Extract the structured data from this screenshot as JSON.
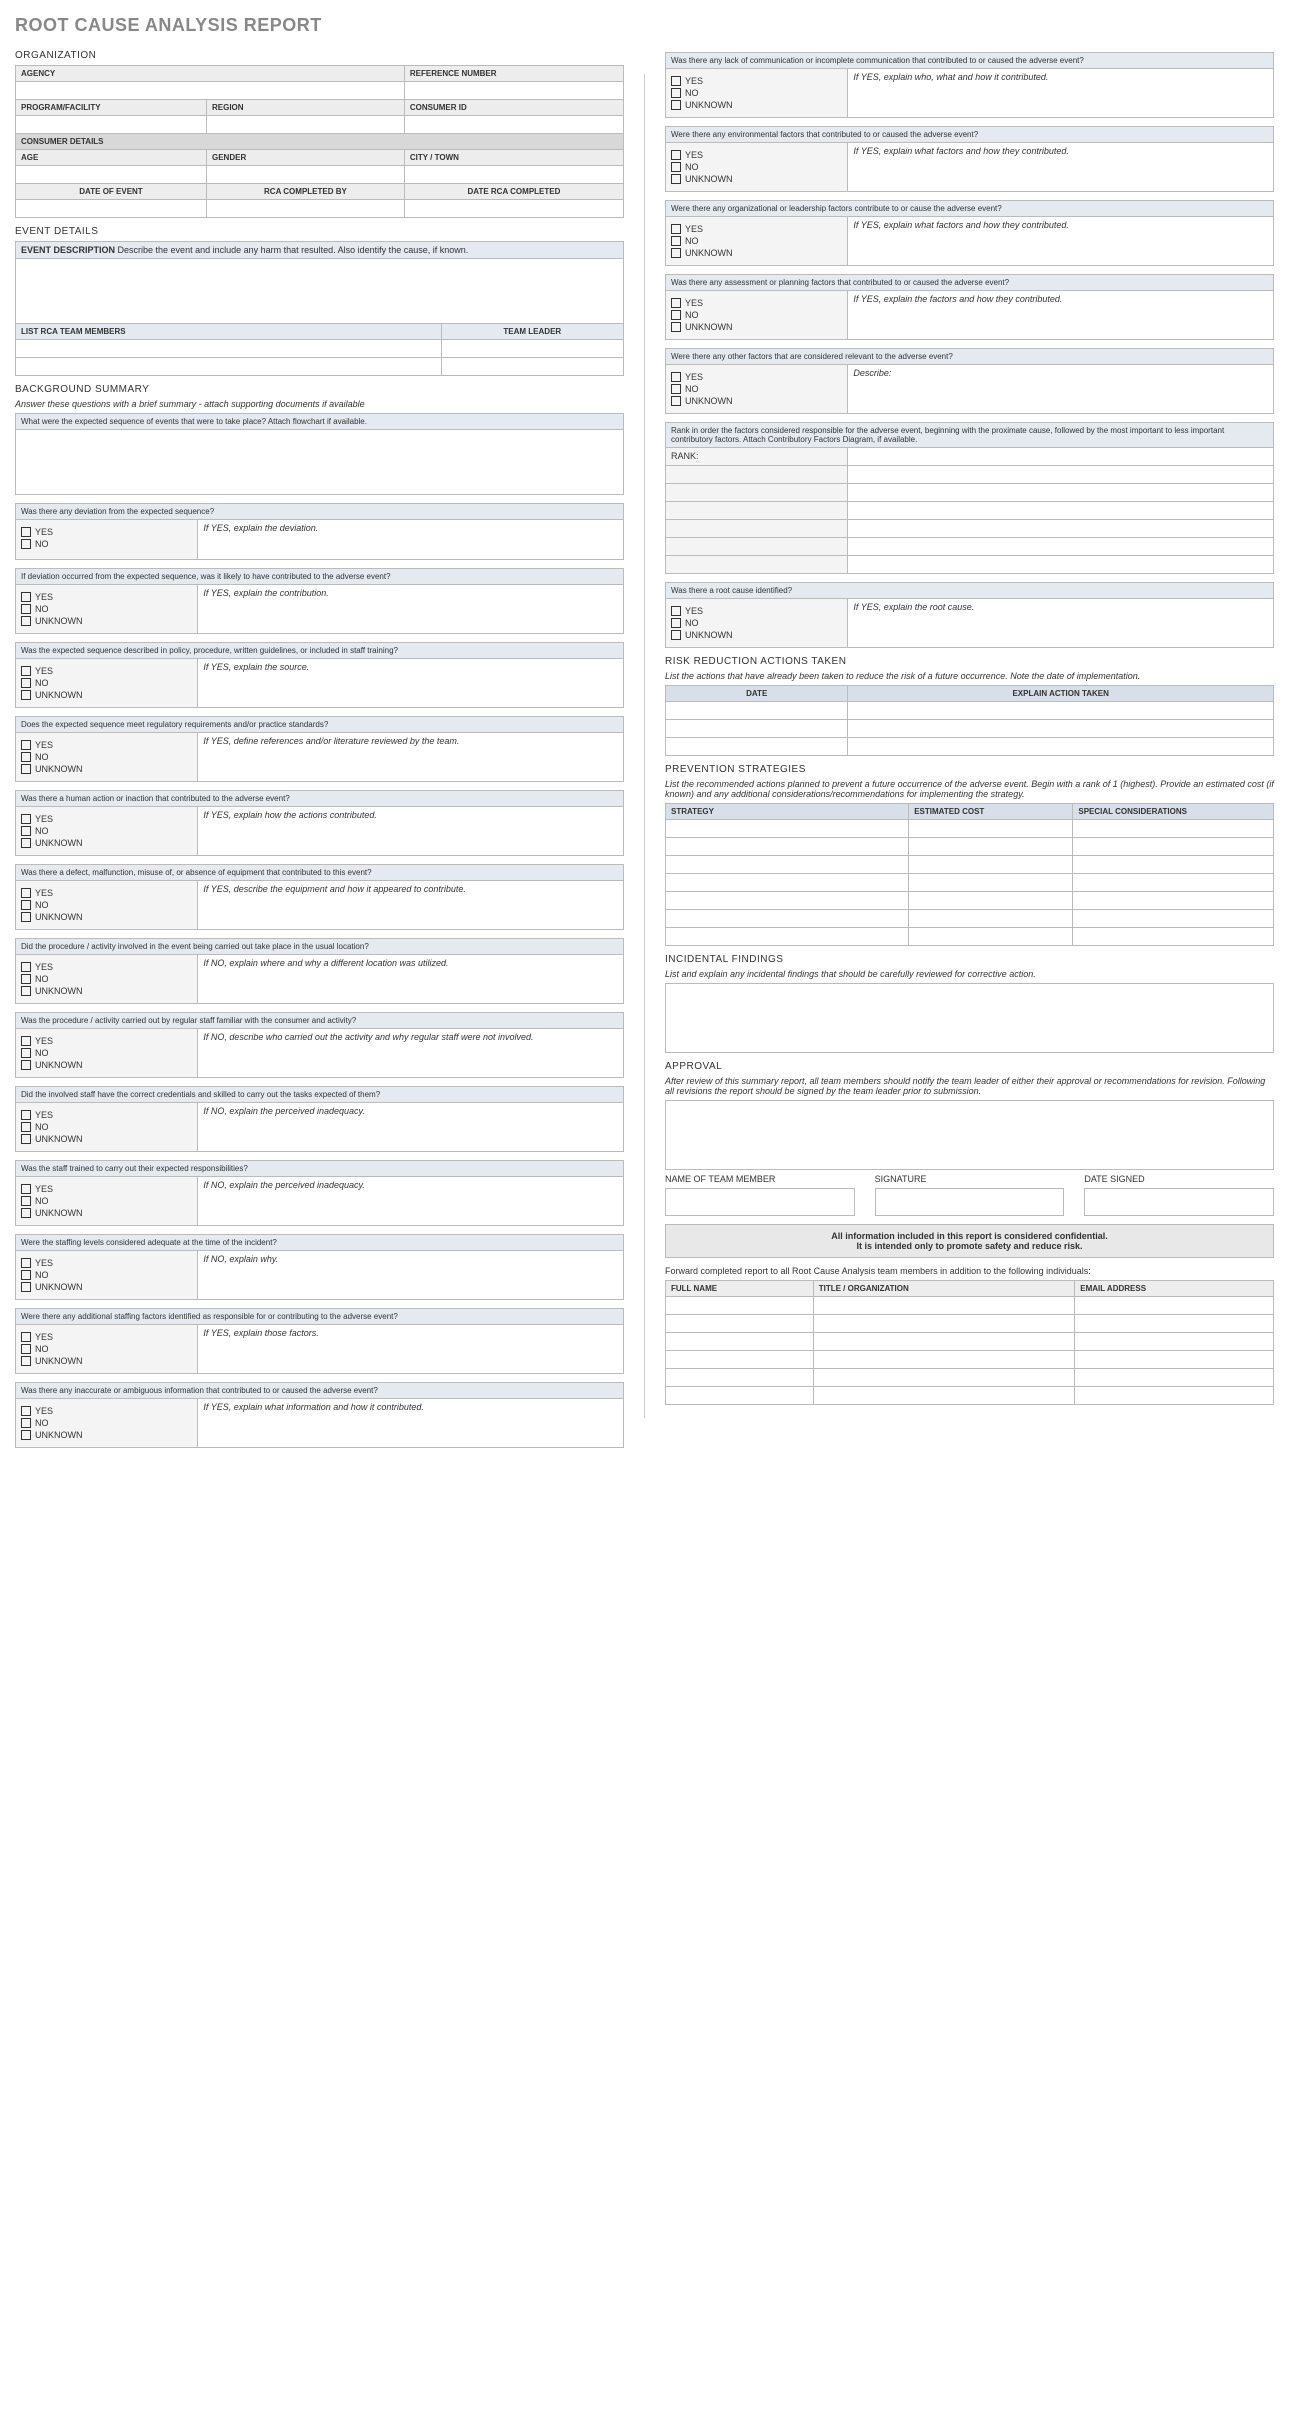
{
  "title": "ROOT CAUSE ANALYSIS REPORT",
  "org": {
    "heading": "ORGANIZATION",
    "agency": "AGENCY",
    "ref": "REFERENCE NUMBER",
    "program": "PROGRAM/FACILITY",
    "region": "REGION",
    "consumer_id": "CONSUMER ID",
    "consumer_details": "CONSUMER DETAILS",
    "age": "AGE",
    "gender": "GENDER",
    "city": "CITY / TOWN",
    "date_event": "DATE OF EVENT",
    "rca_by": "RCA COMPLETED BY",
    "date_rca": "DATE RCA COMPLETED"
  },
  "event": {
    "heading": "EVENT DETAILS",
    "desc_label": "EVENT DESCRIPTION",
    "desc_text": "Describe the event and include any harm that resulted. Also identify the cause, if known.",
    "list_members": "LIST RCA TEAM MEMBERS",
    "team_leader": "TEAM LEADER"
  },
  "bg": {
    "heading": "BACKGROUND SUMMARY",
    "note": "Answer these questions with a brief summary - attach supporting documents if available",
    "q1": "What were the expected sequence of events that were to take place? Attach flowchart if available.",
    "q2": "Was there any deviation from the expected sequence?",
    "q2e": "If YES, explain the deviation.",
    "q3": "If deviation occurred from the expected sequence, was it likely to have contributed to the adverse event?",
    "q3e": "If YES, explain the contribution.",
    "q4": "Was the expected sequence described in policy, procedure, written guidelines, or included in staff training?",
    "q4e": "If YES, explain the source.",
    "q5": "Does the expected sequence meet regulatory requirements and/or practice standards?",
    "q5e": "If YES, define references and/or literature reviewed by the team.",
    "q6": "Was there a human action or inaction that contributed to the adverse event?",
    "q6e": "If YES, explain how the actions contributed.",
    "q7": "Was there a defect, malfunction, misuse of, or absence of equipment that contributed to this event?",
    "q7e": "If YES, describe the equipment and how it appeared to contribute.",
    "q8": "Did the procedure / activity involved in the event being carried out take place in the usual location?",
    "q8e": "If NO, explain where and why a different location was utilized.",
    "q9": "Was the procedure / activity carried out by regular staff familiar with the consumer and activity?",
    "q9e": "If NO, describe who carried out the activity and why regular staff were not involved.",
    "q10": "Did the involved staff have the correct credentials and skilled to carry out the tasks expected of them?",
    "q10e": "If NO, explain the perceived inadequacy.",
    "q11": "Was the staff trained to carry out their expected responsibilities?",
    "q11e": "If NO, explain the perceived inadequacy.",
    "q12": "Were the staffing levels considered adequate at the time of the incident?",
    "q12e": "If NO, explain why.",
    "q13": "Were there any additional staffing factors identified as responsible for or contributing to the adverse event?",
    "q13e": "If YES, explain those factors.",
    "q14": "Was there any inaccurate or ambiguous information that contributed to or caused the adverse event?",
    "q14e": "If YES, explain what information and how it contributed.",
    "q15": "Was there any lack of communication or incomplete communication that contributed to or caused the adverse event?",
    "q15e": "If YES, explain who, what and how it contributed.",
    "q16": "Were there any environmental factors that contributed to or caused the adverse event?",
    "q16e": "If YES, explain what factors and how they contributed.",
    "q17": "Were there any organizational or leadership factors contribute to or cause the adverse event?",
    "q17e": "If YES, explain what factors and how they contributed.",
    "q18": "Was there any assessment or planning factors that contributed to or caused the adverse event?",
    "q18e": "If YES, explain the factors and how they contributed.",
    "q19": "Were there any other factors that are considered relevant to the adverse event?",
    "q19e": "Describe:"
  },
  "yn": {
    "yes": "YES",
    "no": "NO",
    "unknown": "UNKNOWN"
  },
  "rank": {
    "note": "Rank in order the factors considered responsible for the adverse event, beginning with the proximate cause, followed by the most important to less important contributory factors. Attach Contributory Factors Diagram, if available.",
    "label": "RANK:"
  },
  "root": {
    "q": "Was there a root cause identified?",
    "e": "If YES, explain the root cause."
  },
  "risk": {
    "heading": "RISK REDUCTION ACTIONS TAKEN",
    "note": "List the actions that have already been taken to reduce the risk of a future occurrence. Note the date of implementation.",
    "date": "DATE",
    "action": "EXPLAIN ACTION TAKEN"
  },
  "prev": {
    "heading": "PREVENTION STRATEGIES",
    "note": "List the recommended actions planned to prevent a future occurrence of the adverse event. Begin with a rank of 1 (highest). Provide an estimated cost (if known) and any additional considerations/recommendations for implementing the strategy.",
    "strategy": "STRATEGY",
    "cost": "ESTIMATED COST",
    "special": "SPECIAL CONSIDERATIONS"
  },
  "inc": {
    "heading": "INCIDENTAL FINDINGS",
    "note": "List and explain any incidental findings that should be carefully reviewed for corrective action."
  },
  "app": {
    "heading": "APPROVAL",
    "note": "After review of this summary report, all team members should notify the team leader of either their approval or recommendations for revision.  Following all revisions the report should be signed by the team leader prior to submission.",
    "name": "NAME OF TEAM MEMBER",
    "sig": "SIGNATURE",
    "date": "DATE SIGNED",
    "conf1": "All information included in this report is considered confidential.",
    "conf2": "It is intended only to promote safety and reduce risk.",
    "forward": "Forward completed report to all Root Cause Analysis team members in addition to the following individuals:",
    "full": "FULL NAME",
    "title_org": "TITLE / ORGANIZATION",
    "email": "EMAIL ADDRESS"
  }
}
